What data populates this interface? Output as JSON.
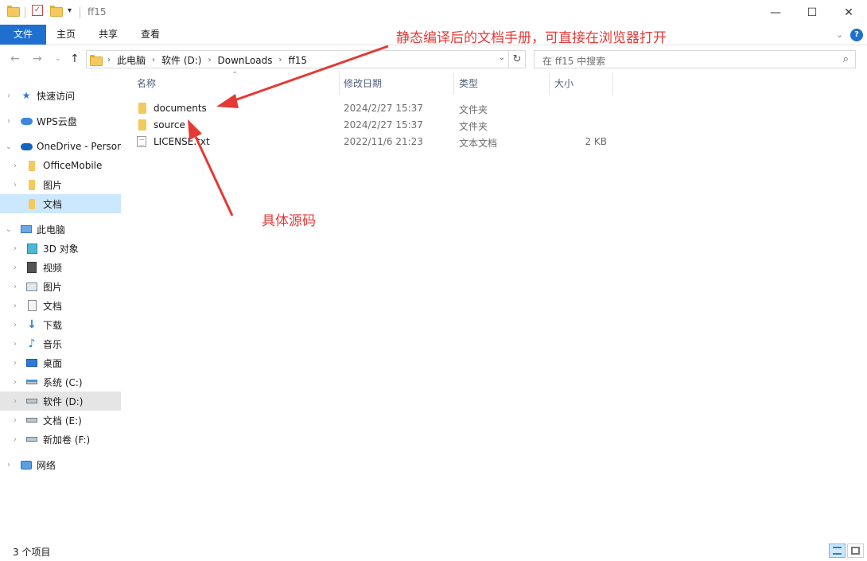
{
  "window": {
    "title": "ff15",
    "minimize_icon": "—",
    "maximize_icon": "☐",
    "close_icon": "✕"
  },
  "ribbon": {
    "tabs": [
      {
        "label": "文件"
      },
      {
        "label": "主页"
      },
      {
        "label": "共享"
      },
      {
        "label": "查看"
      }
    ]
  },
  "address": {
    "breadcrumbs": [
      "此电脑",
      "软件 (D:)",
      "DownLoads",
      "ff15"
    ],
    "search_placeholder": "在 ff15 中搜索"
  },
  "navpane": {
    "items": [
      {
        "label": "快速访问",
        "icon": "star-icon"
      },
      {
        "label": "WPS云盘",
        "icon": "cloud-icon"
      },
      {
        "label": "OneDrive - Personal",
        "icon": "cloud-icon"
      },
      {
        "label": "OfficeMobile",
        "icon": "folder-icon"
      },
      {
        "label": "图片",
        "icon": "folder-icon"
      },
      {
        "label": "文档",
        "icon": "folder-icon"
      },
      {
        "label": "此电脑",
        "icon": "computer-icon"
      },
      {
        "label": "3D 对象",
        "icon": "cube-icon"
      },
      {
        "label": "视频",
        "icon": "video-icon"
      },
      {
        "label": "图片",
        "icon": "picture-icon"
      },
      {
        "label": "文档",
        "icon": "document-icon"
      },
      {
        "label": "下载",
        "icon": "download-icon"
      },
      {
        "label": "音乐",
        "icon": "music-icon"
      },
      {
        "label": "桌面",
        "icon": "desktop-icon"
      },
      {
        "label": "系统 (C:)",
        "icon": "drive-icon"
      },
      {
        "label": "软件 (D:)",
        "icon": "drive-icon"
      },
      {
        "label": "文档 (E:)",
        "icon": "drive-icon"
      },
      {
        "label": "新加卷 (F:)",
        "icon": "drive-icon"
      },
      {
        "label": "网络",
        "icon": "network-icon"
      }
    ]
  },
  "columns": {
    "name": "名称",
    "modified": "修改日期",
    "type": "类型",
    "size": "大小"
  },
  "files": [
    {
      "name": "documents",
      "modified": "2024/2/27 15:37",
      "type": "文件夹",
      "size": "",
      "icon": "folder-icon"
    },
    {
      "name": "source",
      "modified": "2024/2/27 15:37",
      "type": "文件夹",
      "size": "",
      "icon": "folder-icon"
    },
    {
      "name": "LICENSE.txt",
      "modified": "2022/11/6 21:23",
      "type": "文本文档",
      "size": "2 KB",
      "icon": "text-file-icon"
    }
  ],
  "status": {
    "item_count": "3 个项目"
  },
  "annotations": {
    "top_note": "静态编译后的文档手册，可直接在浏览器打开",
    "source_note": "具体源码",
    "color": "#e53935"
  },
  "colors": {
    "accent": "#1e6fcf",
    "selection": "#cce8ff",
    "folder": "#f4c95d"
  }
}
